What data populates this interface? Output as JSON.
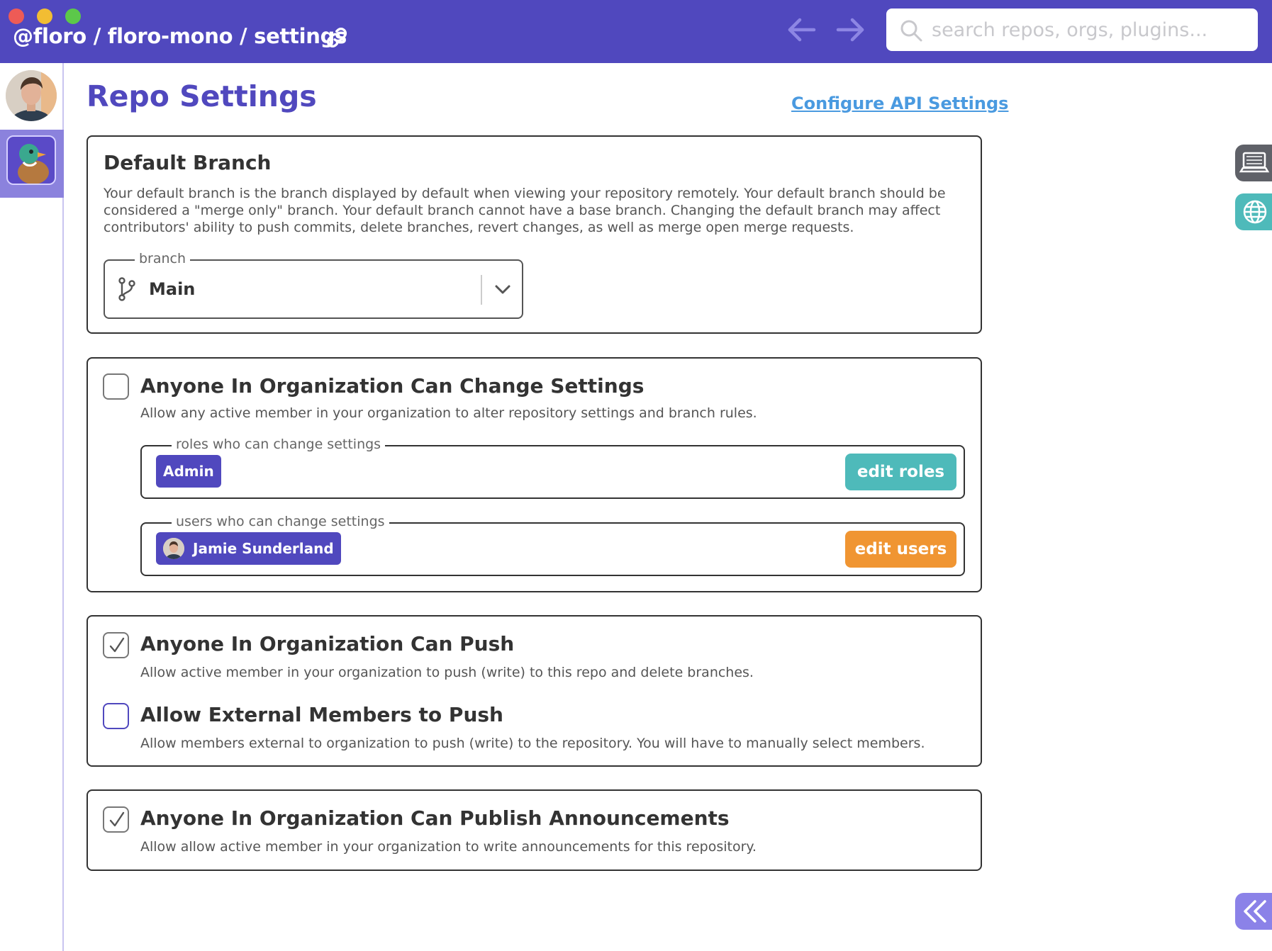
{
  "titlebar": {
    "breadcrumb": "@floro / floro-mono / settings",
    "search_placeholder": "search repos, orgs, plugins...",
    "icons": [
      "link-icon",
      "arrow-left-icon",
      "arrow-right-icon",
      "search-icon"
    ],
    "color": "#5048be"
  },
  "page": {
    "title": "Repo Settings",
    "api_link": "Configure API Settings"
  },
  "default_branch": {
    "title": "Default Branch",
    "description": "Your default branch is the branch displayed by default when viewing your repository remotely. Your default branch should be considered a \"merge only\" branch. Your default branch cannot have a base branch. Changing the default branch may affect contributors' ability to push commits, delete branches, revert changes, as well as merge open merge requests.",
    "select_label": "branch",
    "select_value": "Main"
  },
  "change_settings": {
    "checked": false,
    "title": "Anyone In Organization Can Change Settings",
    "description": "Allow any active member in your organization to alter repository settings and branch rules.",
    "roles_label": "roles who can change settings",
    "roles": [
      "Admin"
    ],
    "edit_roles": "edit roles",
    "users_label": "users who can change settings",
    "users": [
      "Jamie Sunderland"
    ],
    "edit_users": "edit users"
  },
  "push": {
    "can_push": {
      "checked": true,
      "title": "Anyone In Organization Can Push",
      "description": "Allow active member in your organization to push (write) to this repo and delete branches."
    },
    "external": {
      "checked": false,
      "title": "Allow External Members to Push",
      "description": "Allow members external to organization to push (write) to the repository. You will have to manually select members."
    }
  },
  "announcements": {
    "checked": true,
    "title": "Anyone In Organization Can Publish Announcements",
    "description": "Allow allow active member in your organization to write announcements for this repository."
  },
  "colors": {
    "primary": "#5048be",
    "teal": "#4ebaba",
    "orange": "#f09532",
    "link": "#4a9ae0"
  }
}
